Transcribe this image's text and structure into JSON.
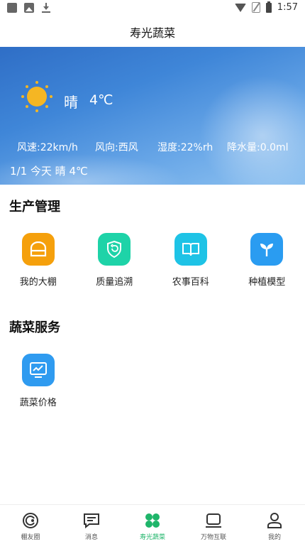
{
  "status_bar": {
    "time": "1:57"
  },
  "app": {
    "title": "寿光蔬菜"
  },
  "weather": {
    "condition": "晴",
    "temperature": "4℃",
    "wind_speed": "风速:22km/h",
    "wind_direction": "风向:西风",
    "humidity": "湿度:22%rh",
    "precipitation": "降水量:0.0ml",
    "date_line": "1/1 今天 晴 4℃",
    "icon": "sun-icon"
  },
  "production": {
    "title": "生产管理",
    "items": [
      {
        "label": "我的大棚",
        "icon": "greenhouse-icon",
        "color": "#f5a00c"
      },
      {
        "label": "质量追溯",
        "icon": "shield-trace-icon",
        "color": "#1ed3a8"
      },
      {
        "label": "农事百科",
        "icon": "book-icon",
        "color": "#1ec3e6"
      },
      {
        "label": "种植模型",
        "icon": "sprout-icon",
        "color": "#2a9cf1"
      }
    ]
  },
  "vegetable": {
    "title": "蔬菜服务",
    "items": [
      {
        "label": "蔬菜价格",
        "icon": "price-chart-icon",
        "color": "#2f9bf0"
      }
    ]
  },
  "nav": {
    "items": [
      {
        "label": "棚友圈",
        "icon": "circle-icon"
      },
      {
        "label": "消息",
        "icon": "message-icon"
      },
      {
        "label": "寿光蔬菜",
        "icon": "clover-icon"
      },
      {
        "label": "万物互联",
        "icon": "devices-icon"
      },
      {
        "label": "我的",
        "icon": "profile-icon"
      }
    ],
    "active_color": "#1fb56a"
  }
}
